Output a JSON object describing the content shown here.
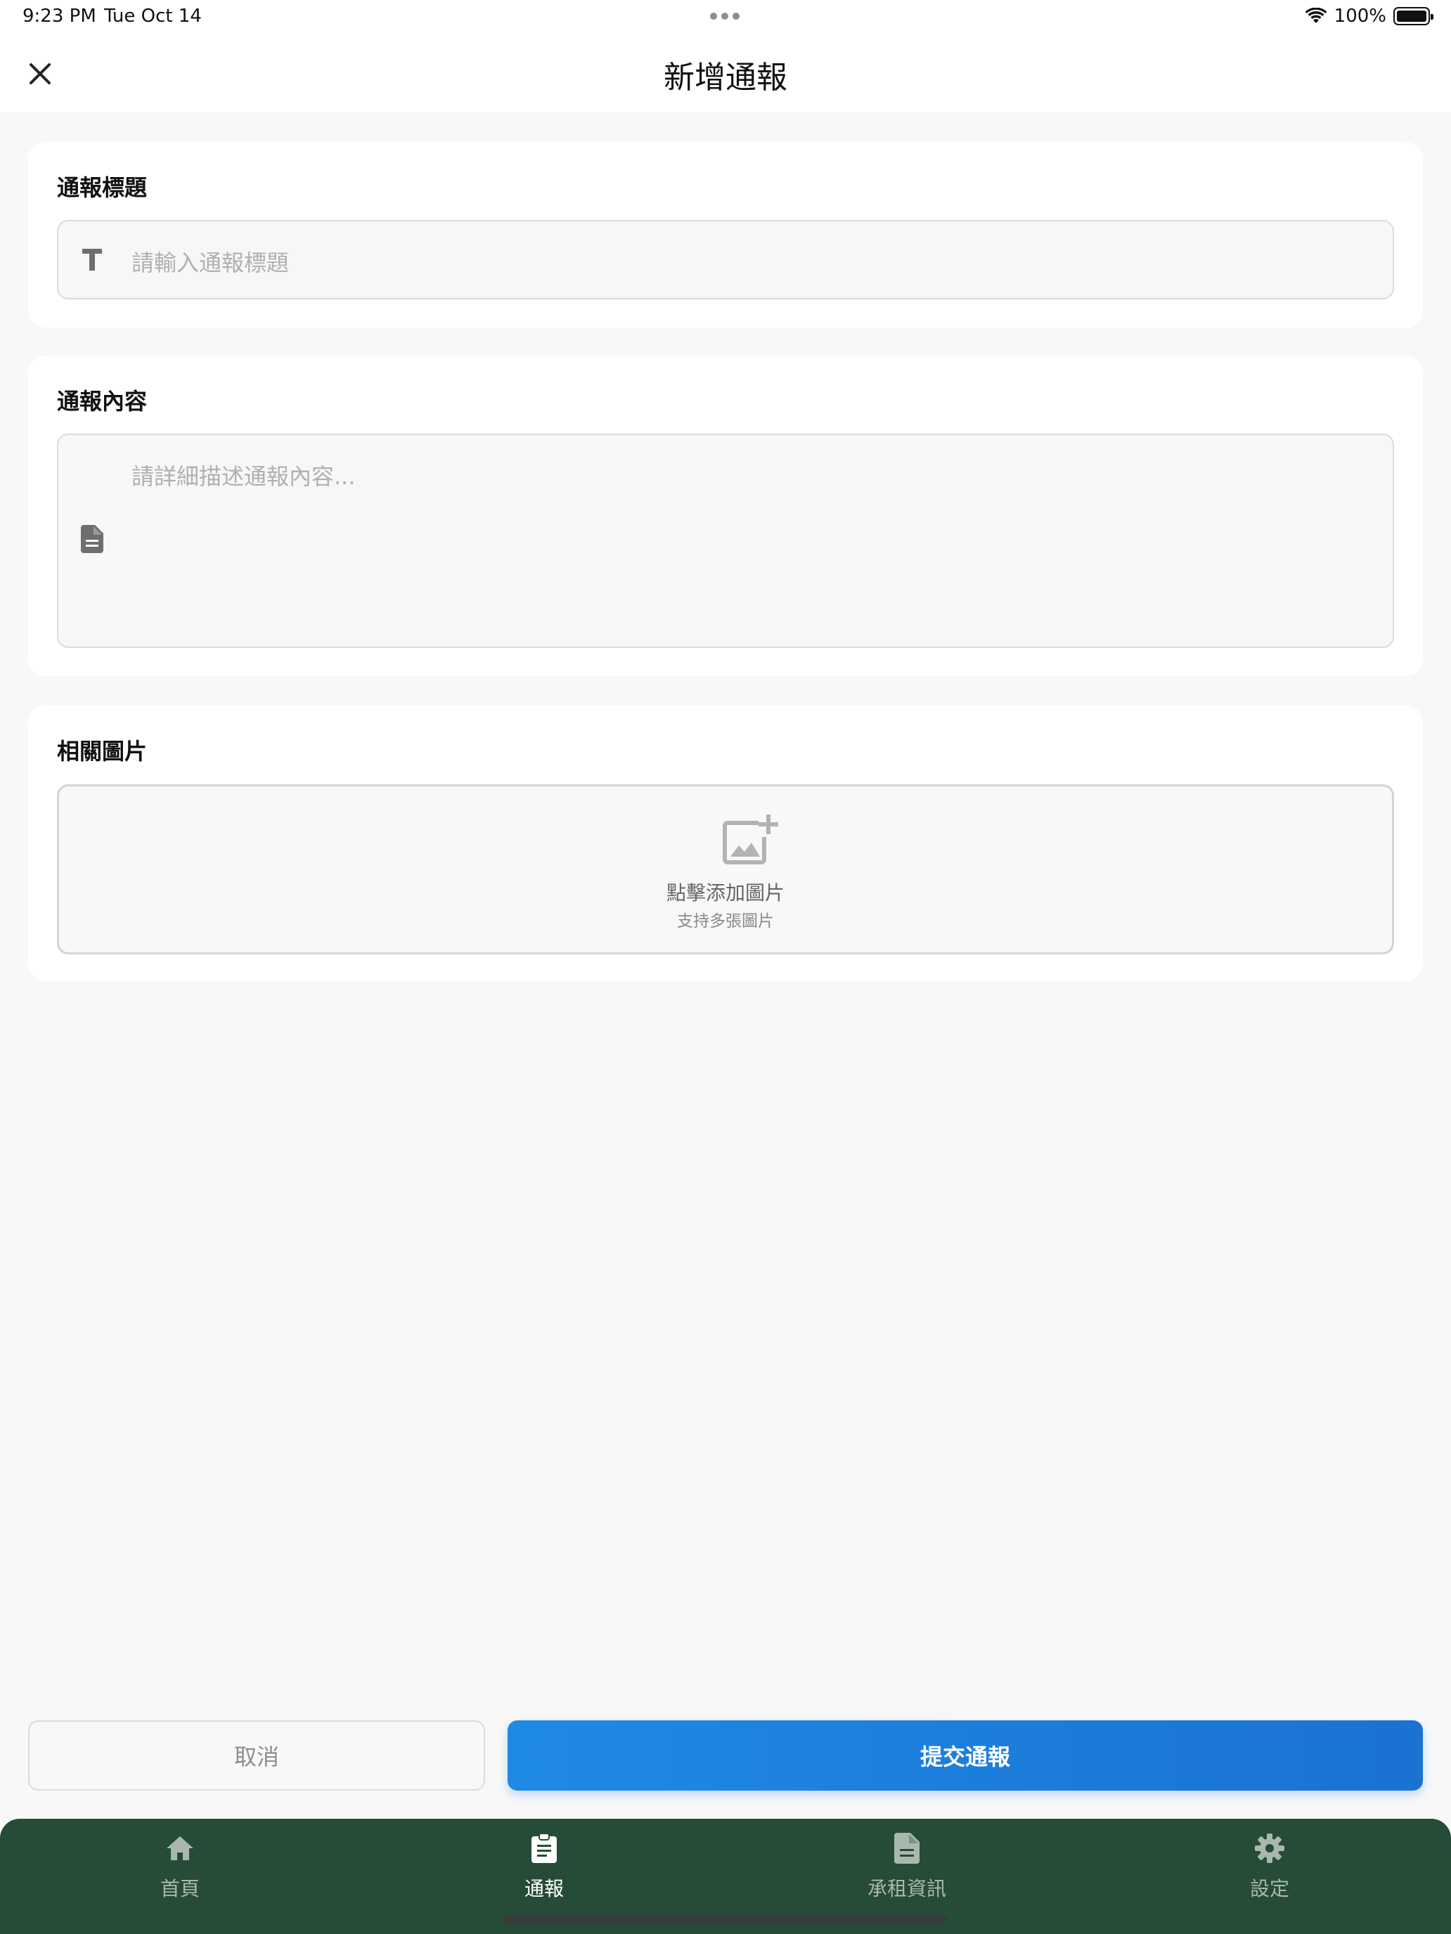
{
  "status_bar": {
    "time": "9:23 PM",
    "date": "Tue Oct 14",
    "battery": "100%",
    "icons": [
      "wifi-icon",
      "battery-icon"
    ]
  },
  "header": {
    "title": "新增通報",
    "close_icon": "close-icon"
  },
  "title_section": {
    "label": "通報標題",
    "placeholder": "請輸入通報標題",
    "value": "",
    "icon": "text-format-icon"
  },
  "content_section": {
    "label": "通報內容",
    "placeholder": "請詳細描述通報內容...",
    "value": "",
    "icon": "document-icon"
  },
  "image_section": {
    "label": "相關圖片",
    "upload_text": "點擊添加圖片",
    "upload_subtext": "支持多張圖片",
    "icon": "add-photo-icon"
  },
  "actions": {
    "cancel_label": "取消",
    "submit_label": "提交通報"
  },
  "tab_bar": {
    "items": [
      {
        "label": "首頁",
        "icon": "home-icon",
        "active": false
      },
      {
        "label": "通報",
        "icon": "clipboard-icon",
        "active": true
      },
      {
        "label": "承租資訊",
        "icon": "document-icon",
        "active": false
      },
      {
        "label": "設定",
        "icon": "gear-icon",
        "active": false
      }
    ]
  },
  "colors": {
    "primary": "#1f86e2",
    "tab_bar_bg": "#264b36",
    "background": "#f8f8f8"
  }
}
